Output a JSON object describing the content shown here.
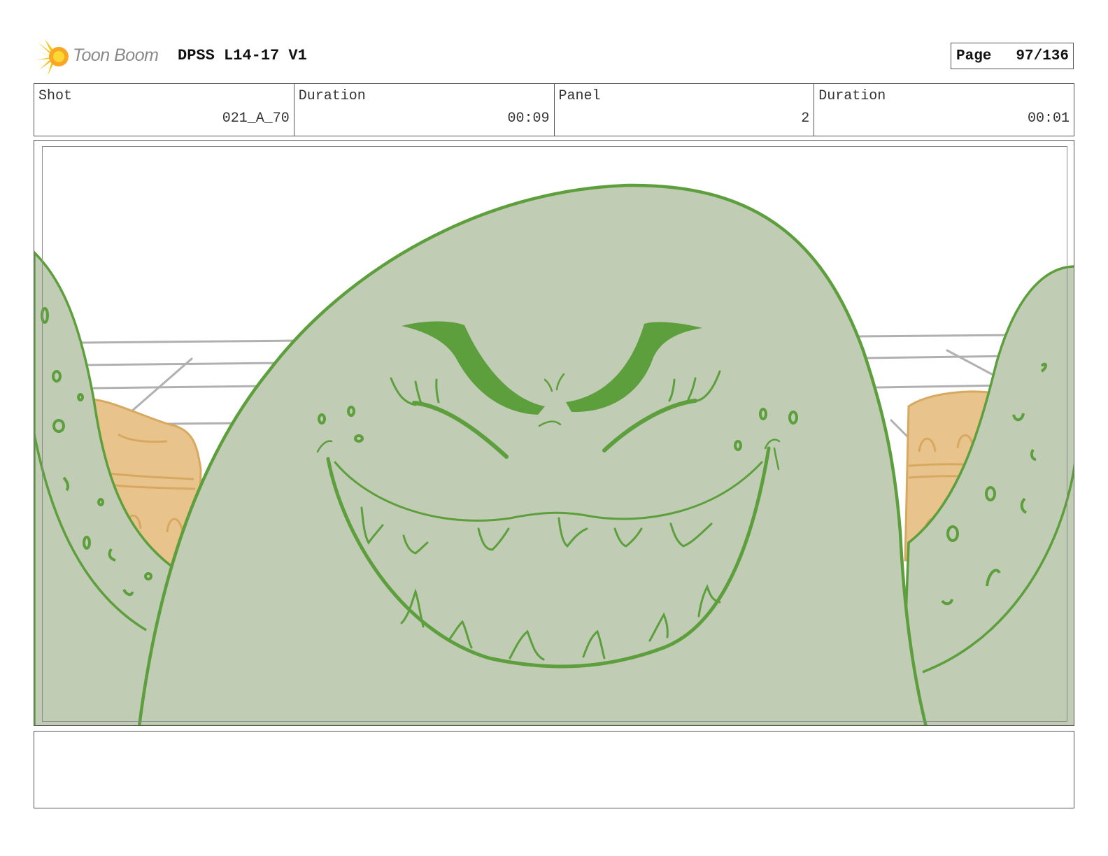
{
  "header": {
    "logo_text": "Toon Boom",
    "project_title": "DPSS L14-17 V1",
    "page_label": "Page",
    "page_value": "97/136"
  },
  "info": {
    "shot_label": "Shot",
    "shot_value": "021_A_70",
    "shot_duration_label": "Duration",
    "shot_duration_value": "00:09",
    "panel_label": "Panel",
    "panel_value": "2",
    "panel_duration_label": "Duration",
    "panel_duration_value": "00:01"
  },
  "notes": {
    "text": ""
  },
  "colors": {
    "monster_fill": "#c0ccb4",
    "monster_line": "#5c9f3c",
    "skin_fill": "#e8c48c",
    "skin_line": "#d8a860",
    "background_lines": "#b0b0b0"
  }
}
